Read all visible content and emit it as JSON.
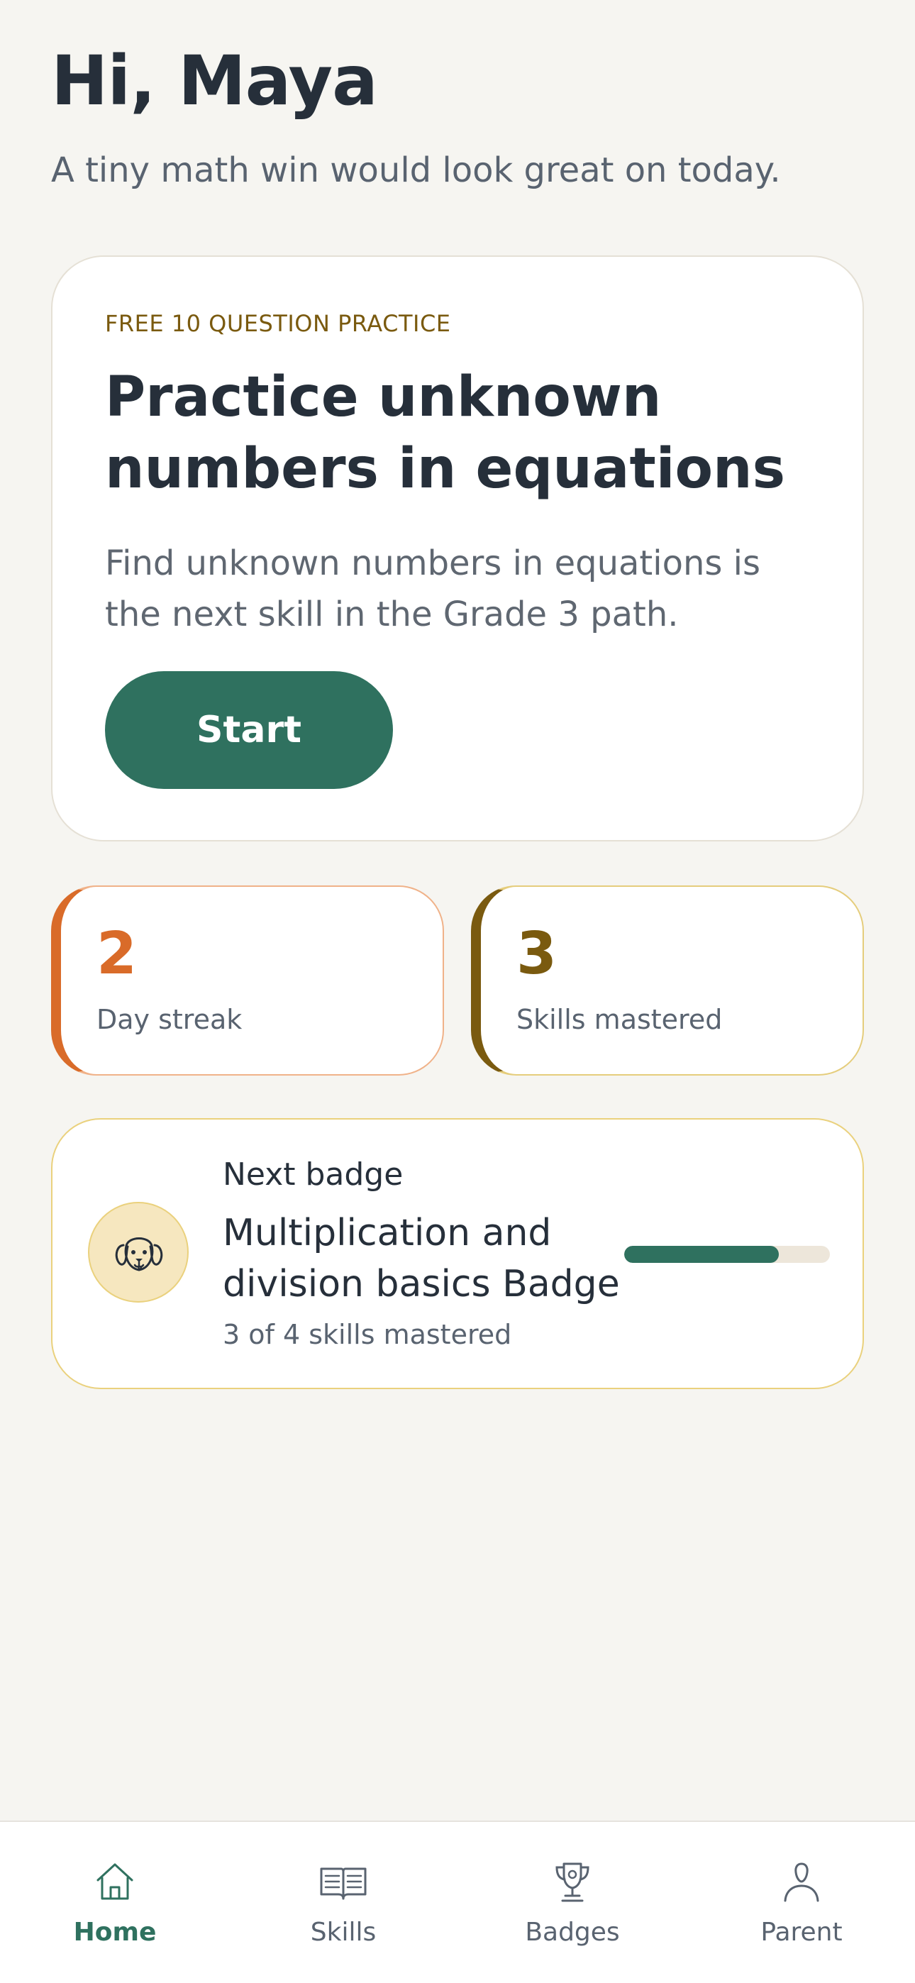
{
  "greeting": {
    "title": "Hi, Maya",
    "subtitle": "A tiny math win would look great on today."
  },
  "practice_card": {
    "tag": "FREE 10 QUESTION PRACTICE",
    "heading": "Practice unknown numbers in equations",
    "description": "Find unknown numbers in equations is the next skill in the Grade 3 path.",
    "button_label": "Start"
  },
  "stats": [
    {
      "value": "2",
      "label": "Day streak",
      "accent_color": "#d96b29"
    },
    {
      "value": "3",
      "label": "Skills mastered",
      "accent_color": "#7a5a0f"
    }
  ],
  "next_badge": {
    "label": "Next badge",
    "title": "Multiplication and division basics Badge",
    "progress_text": "3 of 4 skills mastered",
    "progress_fraction": 0.75,
    "icon": "dog-icon"
  },
  "bottom_nav": {
    "items": [
      {
        "label": "Home",
        "icon": "home-icon",
        "active": true
      },
      {
        "label": "Skills",
        "icon": "book-icon",
        "active": false
      },
      {
        "label": "Badges",
        "icon": "trophy-icon",
        "active": false
      },
      {
        "label": "Parent",
        "icon": "person-icon",
        "active": false
      }
    ]
  },
  "colors": {
    "background": "#f6f5f1",
    "primary_green": "#2f715f",
    "streak_orange": "#d96b29",
    "mastered_brown": "#7a5a0f"
  }
}
